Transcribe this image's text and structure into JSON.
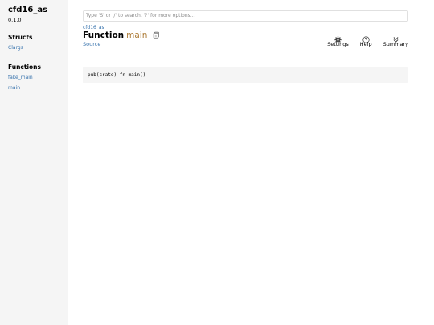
{
  "sidebar": {
    "crate_name": "cfd16_as",
    "version": "0.1.0",
    "structs_heading": "Structs",
    "structs": [
      {
        "label": "Clargs"
      }
    ],
    "functions_heading": "Functions",
    "functions": [
      {
        "label": "fake_main"
      },
      {
        "label": "main"
      }
    ]
  },
  "search": {
    "placeholder": "Type 'S' or '/' to search, '?' for more options…"
  },
  "main": {
    "breadcrumb": "cfd16_as",
    "title_kind": "Function",
    "title_name": "main",
    "source_label": "Source",
    "code": "pub(crate) fn main()"
  },
  "toolbar": {
    "settings_label": "Settings",
    "help_label": "Help",
    "summary_label": "Summary"
  },
  "colors": {
    "link": "#3873ad",
    "function_name": "#ad7c37",
    "sidebar_bg": "#f5f5f5",
    "code_bg": "#f5f5f5"
  },
  "icons": {
    "copy": "copy-icon",
    "settings": "gear-icon",
    "help": "question-circle-icon",
    "summary": "double-chevron-down-icon"
  }
}
